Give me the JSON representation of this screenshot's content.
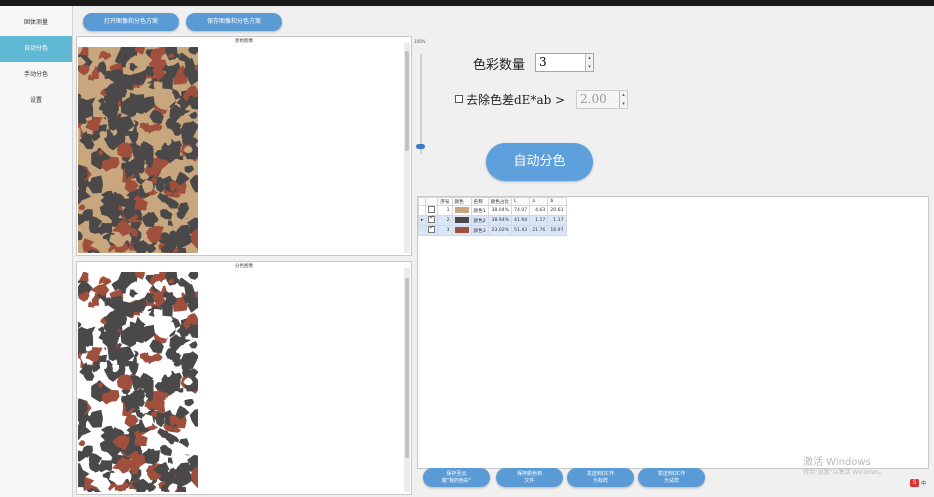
{
  "sidebar": {
    "items": [
      {
        "label": "固体测量",
        "active": false
      },
      {
        "label": "自动分色",
        "active": true
      },
      {
        "label": "手动分色",
        "active": false
      },
      {
        "label": "设置",
        "active": false
      }
    ]
  },
  "toolbar": {
    "open_scheme_label": "打开图像和分色方案",
    "save_scheme_label": "保存图像和分色方案"
  },
  "original_panel": {
    "title": "原始图像"
  },
  "separated_panel": {
    "title": "分色图像"
  },
  "slider": {
    "label": "100%",
    "value_percent": 3
  },
  "settings": {
    "color_count_label": "色彩数量",
    "color_count_value": "3",
    "remove_diff_label": "去除色差dE*ab >",
    "remove_diff_checked": false,
    "remove_diff_value": "2.00",
    "auto_button_label": "自动分色"
  },
  "table": {
    "columns": [
      "",
      "",
      "序号",
      "颜色",
      "名称",
      "颜色占比",
      "L",
      "a",
      "b"
    ],
    "rows": [
      {
        "marker": "",
        "checked": false,
        "index": "1",
        "color": "#c9a77e",
        "name": "颜色1",
        "ratio": "38.04%",
        "L": "74.07",
        "a": "4.63",
        "b": "20.61"
      },
      {
        "marker": "▸",
        "checked": true,
        "index": "2",
        "color": "#4a4848",
        "name": "颜色2",
        "ratio": "38.94%",
        "L": "41.94",
        "a": "1.17",
        "b": "1.17"
      },
      {
        "marker": "",
        "checked": true,
        "index": "3",
        "color": "#a04f3c",
        "name": "颜色3",
        "ratio": "23.02%",
        "L": "51.43",
        "a": "21.76",
        "b": "16.97"
      }
    ]
  },
  "bottom_buttons": [
    {
      "label": "保存至云\n端\"我的色彩\""
    },
    {
      "label": "保存颜色到\n文件"
    },
    {
      "label": "发送到QC作\n为标样"
    },
    {
      "label": "发送到QC作\n为试样"
    }
  ],
  "watermark": {
    "line1": "激活 Windows",
    "line2": "转到\"设置\"以激活 Windows。"
  },
  "tray": {
    "icon_text": "S",
    "text": "中"
  },
  "colors": {
    "accent": "#5b9bd5",
    "sidebar_active": "#5fb8d4",
    "tan": "#c9a77e",
    "dark": "#4a4848",
    "rust": "#a04f3c"
  }
}
